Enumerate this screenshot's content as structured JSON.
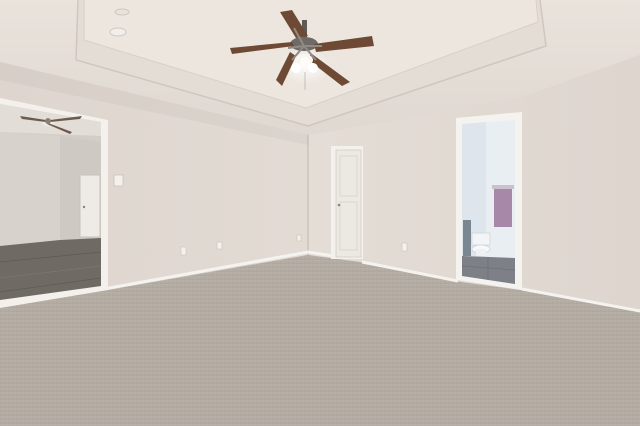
{
  "scene": {
    "kind": "photo",
    "subject": "empty-room-interior",
    "colors": {
      "wall": "#e3dcd5",
      "wall_shadow": "#d6cec7",
      "ceiling": "#ece6df",
      "tray": "#e6e0d9",
      "carpet": "#bdb4ab",
      "baseboard": "#f7f5f2",
      "fan_blade": "#6e4a34",
      "floor_wood": "#6b6660",
      "towel": "#a788a8"
    }
  }
}
